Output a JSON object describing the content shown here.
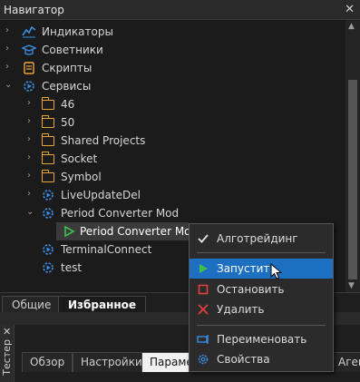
{
  "window": {
    "title": "Навигатор",
    "close_glyph": "✕"
  },
  "tree": {
    "items": [
      {
        "label": "Индикаторы",
        "icon": "indicators-icon"
      },
      {
        "label": "Советники",
        "icon": "advisors-icon"
      },
      {
        "label": "Скрипты",
        "icon": "scripts-icon"
      },
      {
        "label": "Сервисы",
        "icon": "services-icon"
      },
      {
        "label": "46",
        "icon": "folder-icon"
      },
      {
        "label": "50",
        "icon": "folder-icon"
      },
      {
        "label": "Shared Projects",
        "icon": "folder-icon"
      },
      {
        "label": "Socket",
        "icon": "folder-icon"
      },
      {
        "label": "Symbol",
        "icon": "folder-icon"
      },
      {
        "label": "LiveUpdateDel",
        "icon": "service-icon"
      },
      {
        "label": "Period Converter Mod",
        "icon": "service-icon"
      },
      {
        "label": "Period Converter Mod",
        "icon": "play-icon"
      },
      {
        "label": "TerminalConnect",
        "icon": "service-icon"
      },
      {
        "label": "test",
        "icon": "service-icon"
      }
    ]
  },
  "nav_tabs": [
    {
      "label": "Общие"
    },
    {
      "label": "Избранное"
    }
  ],
  "tester": {
    "side_label": "Тестер",
    "close_glyph": "✕",
    "tabs": [
      {
        "label": "Обзор"
      },
      {
        "label": "Настройки"
      },
      {
        "label": "Параме"
      },
      {
        "label": "Аген"
      }
    ]
  },
  "context_menu": {
    "items": [
      {
        "label": "Алготрейдинг",
        "icon": "check-icon"
      },
      {
        "label": "Запустить",
        "icon": "play-icon"
      },
      {
        "label": "Остановить",
        "icon": "stop-icon"
      },
      {
        "label": "Удалить",
        "icon": "delete-icon"
      },
      {
        "label": "Переименовать",
        "icon": "rename-icon"
      },
      {
        "label": "Свойства",
        "icon": "gear-icon"
      }
    ]
  },
  "colors": {
    "accent": "#1d6fc1",
    "folder": "#e9a53a",
    "service_icon": "#3a8de0",
    "play": "#3ec04c",
    "stop": "#e04040"
  }
}
